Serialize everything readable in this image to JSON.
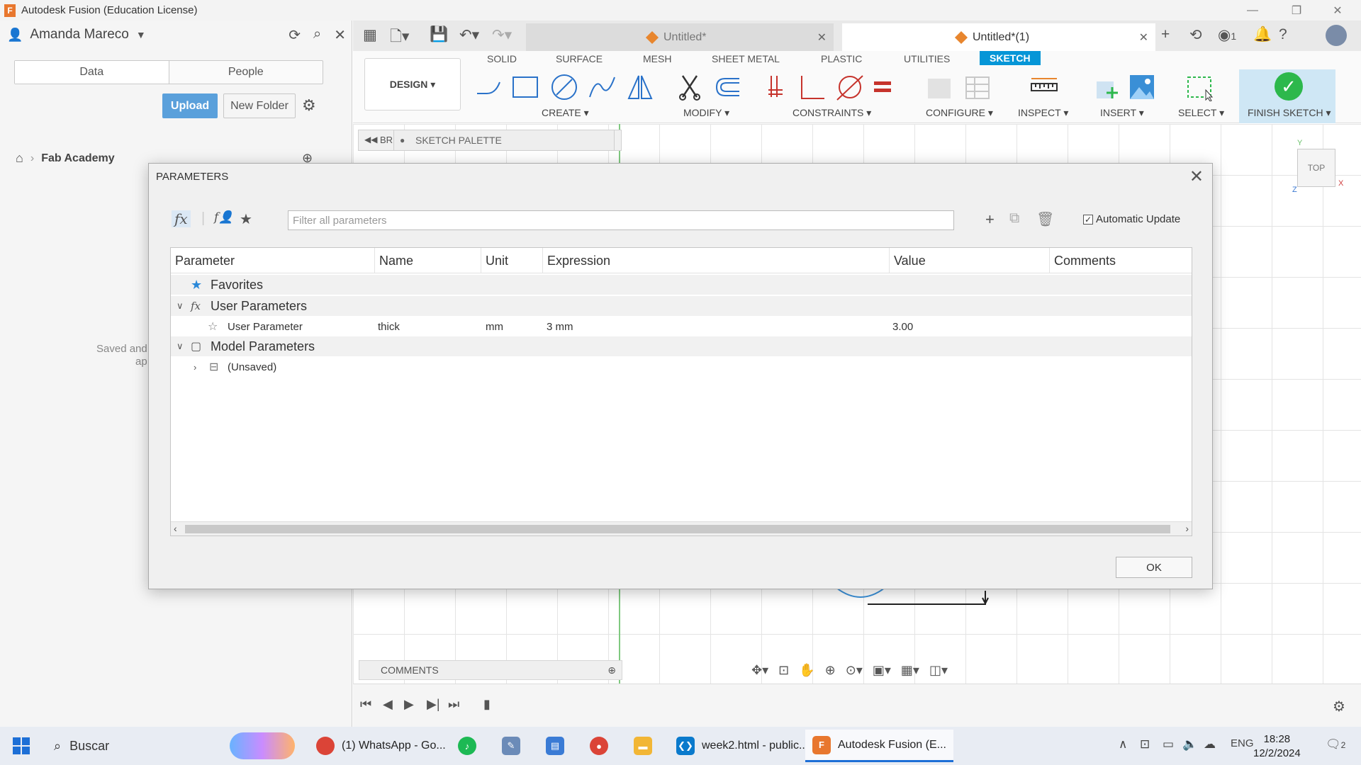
{
  "window": {
    "title": "Autodesk Fusion (Education License)"
  },
  "datapanel": {
    "user_name": "Amanda Mareco",
    "tabs": [
      "Data",
      "People"
    ],
    "upload_label": "Upload",
    "new_folder_label": "New Folder",
    "breadcrumb": "Fab Academy",
    "saved_text_1": "Saved and",
    "saved_text_2": "ap"
  },
  "doc_tabs": [
    {
      "label": "Untitled*",
      "active": false
    },
    {
      "label": "Untitled*(1)",
      "active": true
    }
  ],
  "tabbar": {
    "notifications_count": "1"
  },
  "ribbon": {
    "workspace_tabs": [
      "SOLID",
      "SURFACE",
      "MESH",
      "SHEET METAL",
      "PLASTIC",
      "UTILITIES",
      "SKETCH"
    ],
    "active_tab": "SKETCH",
    "design_label": "DESIGN ▾",
    "groups": [
      "CREATE ▾",
      "MODIFY ▾",
      "CONSTRAINTS ▾",
      "CONFIGURE ▾",
      "INSPECT ▾",
      "INSERT ▾",
      "SELECT ▾",
      "FINISH SKETCH ▾"
    ]
  },
  "canvas": {
    "browser_label": "BR",
    "browser_item": "(Unsaved)",
    "palette_label": "SKETCH PALETTE",
    "viewcube_label": "TOP",
    "comments_label": "COMMENTS",
    "axes": {
      "y": "Y",
      "x": "X",
      "z": "Z"
    }
  },
  "dialog": {
    "title": "PARAMETERS",
    "filter_placeholder": "Filter all parameters",
    "auto_update_label": "Automatic Update",
    "auto_update_checked": true,
    "columns": [
      "Parameter",
      "Name",
      "Unit",
      "Expression",
      "Value",
      "Comments"
    ],
    "groups": {
      "favorites": "Favorites",
      "user": "User Parameters",
      "model": "Model Parameters"
    },
    "user_params": [
      {
        "parameter": "User Parameter",
        "name": "thick",
        "unit": "mm",
        "expression": "3 mm",
        "value": "3.00",
        "comments": ""
      }
    ],
    "model_children": [
      "(Unsaved)"
    ],
    "ok_label": "OK"
  },
  "taskbar": {
    "search_placeholder": "Buscar",
    "apps": [
      {
        "label": "(1) WhatsApp - Go...",
        "color": "#db4437"
      },
      {
        "label": "week2.html - public...",
        "color": "#0a7acc"
      },
      {
        "label": "Autodesk Fusion (E...",
        "color": "#e8772e"
      }
    ],
    "language": "ENG",
    "time": "18:28",
    "date": "12/2/2024",
    "notification_badge": "2"
  }
}
